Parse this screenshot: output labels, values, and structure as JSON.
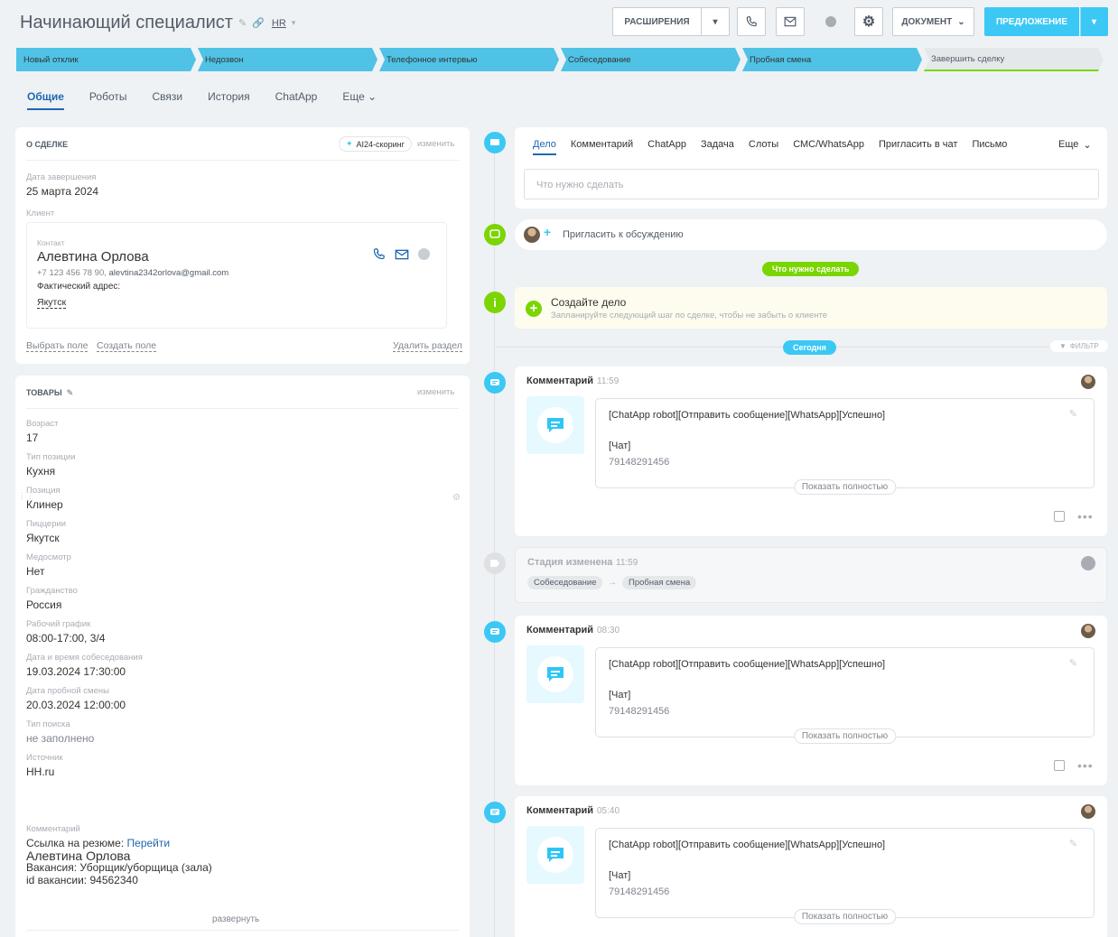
{
  "header": {
    "title": "Начинающий специалист",
    "category": "HR",
    "buttons": {
      "extensions": "РАСШИРЕНИЯ",
      "document": "ДОКУМЕНТ",
      "offer": "ПРЕДЛОЖЕНИЕ"
    }
  },
  "stages": [
    "Новый отклик",
    "Недозвон",
    "Телефонное интервью",
    "Собеседование",
    "Пробная смена",
    "Завершить сделку"
  ],
  "tabs": [
    "Общие",
    "Роботы",
    "Связи",
    "История",
    "ChatApp",
    "Еще"
  ],
  "about": {
    "title": "О СДЕЛКЕ",
    "ai_badge": "AI24-скоринг",
    "edit": "изменить",
    "close_date_label": "Дата завершения",
    "close_date": "25 марта 2024",
    "client_label": "Клиент",
    "contact_label": "Контакт",
    "contact_name": "Алевтина Орлова",
    "phone": "+7 123 456 78 90,",
    "email": "alevtina2342orlova@gmail.com",
    "address_label": "Фактический адрес:",
    "address": "Якутск",
    "select_field": "Выбрать поле",
    "create_field": "Создать поле",
    "delete_section": "Удалить раздел"
  },
  "goods": {
    "title": "ТОВАРЫ",
    "edit": "изменить",
    "fields": [
      {
        "label": "Возраст",
        "value": "17"
      },
      {
        "label": "Тип позиции",
        "value": "Кухня"
      },
      {
        "label": "Позиция",
        "value": "Клинер"
      },
      {
        "label": "Пиццерии",
        "value": "Якутск"
      },
      {
        "label": "Медосмотр",
        "value": "Нет"
      },
      {
        "label": "Гражданство",
        "value": "Россия"
      },
      {
        "label": "Рабочий график",
        "value": "08:00-17:00, 3/4"
      },
      {
        "label": "Дата и время собеседования",
        "value": "19.03.2024 17:30:00"
      },
      {
        "label": "Дата пробной смены",
        "value": "20.03.2024 12:00:00"
      },
      {
        "label": "Тип поиска",
        "value": "не заполнено"
      },
      {
        "label": "Источник",
        "value": "HH.ru"
      }
    ],
    "comment_label": "Комментарий",
    "comment_resume": "Ссылка на резюме:",
    "comment_link": "Перейти",
    "comment_name": "Алевтина Орлова",
    "comment_vacancy": "Вакансия: Уборщик/уборщица (зала)",
    "comment_id": "id вакансии: 94562340",
    "expand": "развернуть"
  },
  "activity": {
    "tabs": [
      "Дело",
      "Комментарий",
      "ChatApp",
      "Задача",
      "Слоты",
      "СМС/WhatsApp",
      "Пригласить в чат",
      "Письмо"
    ],
    "more": "Еще",
    "placeholder": "Что нужно сделать",
    "invite": "Пригласить к обсуждению",
    "todo_pill": "Что нужно сделать",
    "create_title": "Создайте дело",
    "create_sub": "Запланируйте следующий шаг по сделке, чтобы не забыть о клиенте",
    "today": "Сегодня",
    "filter": "ФИЛЬТР"
  },
  "timeline": {
    "comments": [
      {
        "title": "Комментарий",
        "time": "11:59",
        "text": "[ChatApp robot][Отправить сообщение][WhatsApp][Успешно]",
        "chat": "[Чат]",
        "phone": "79148291456",
        "show": "Показать полностью"
      },
      {
        "title": "Комментарий",
        "time": "08:30",
        "text": "[ChatApp robot][Отправить сообщение][WhatsApp][Успешно]",
        "chat": "[Чат]",
        "phone": "79148291456",
        "show": "Показать полностью"
      },
      {
        "title": "Комментарий",
        "time": "05:40",
        "text": "[ChatApp robot][Отправить сообщение][WhatsApp][Успешно]",
        "chat": "[Чат]",
        "phone": "79148291456",
        "show": "Показать полностью"
      }
    ],
    "stage_change": {
      "title": "Стадия изменена",
      "time": "11:59",
      "from": "Собеседование",
      "to": "Пробная смена"
    }
  },
  "colors": {
    "accent": "#3bc8f5",
    "green": "#7bd500",
    "stage": "#4fc2e6",
    "link": "#2067b0"
  }
}
